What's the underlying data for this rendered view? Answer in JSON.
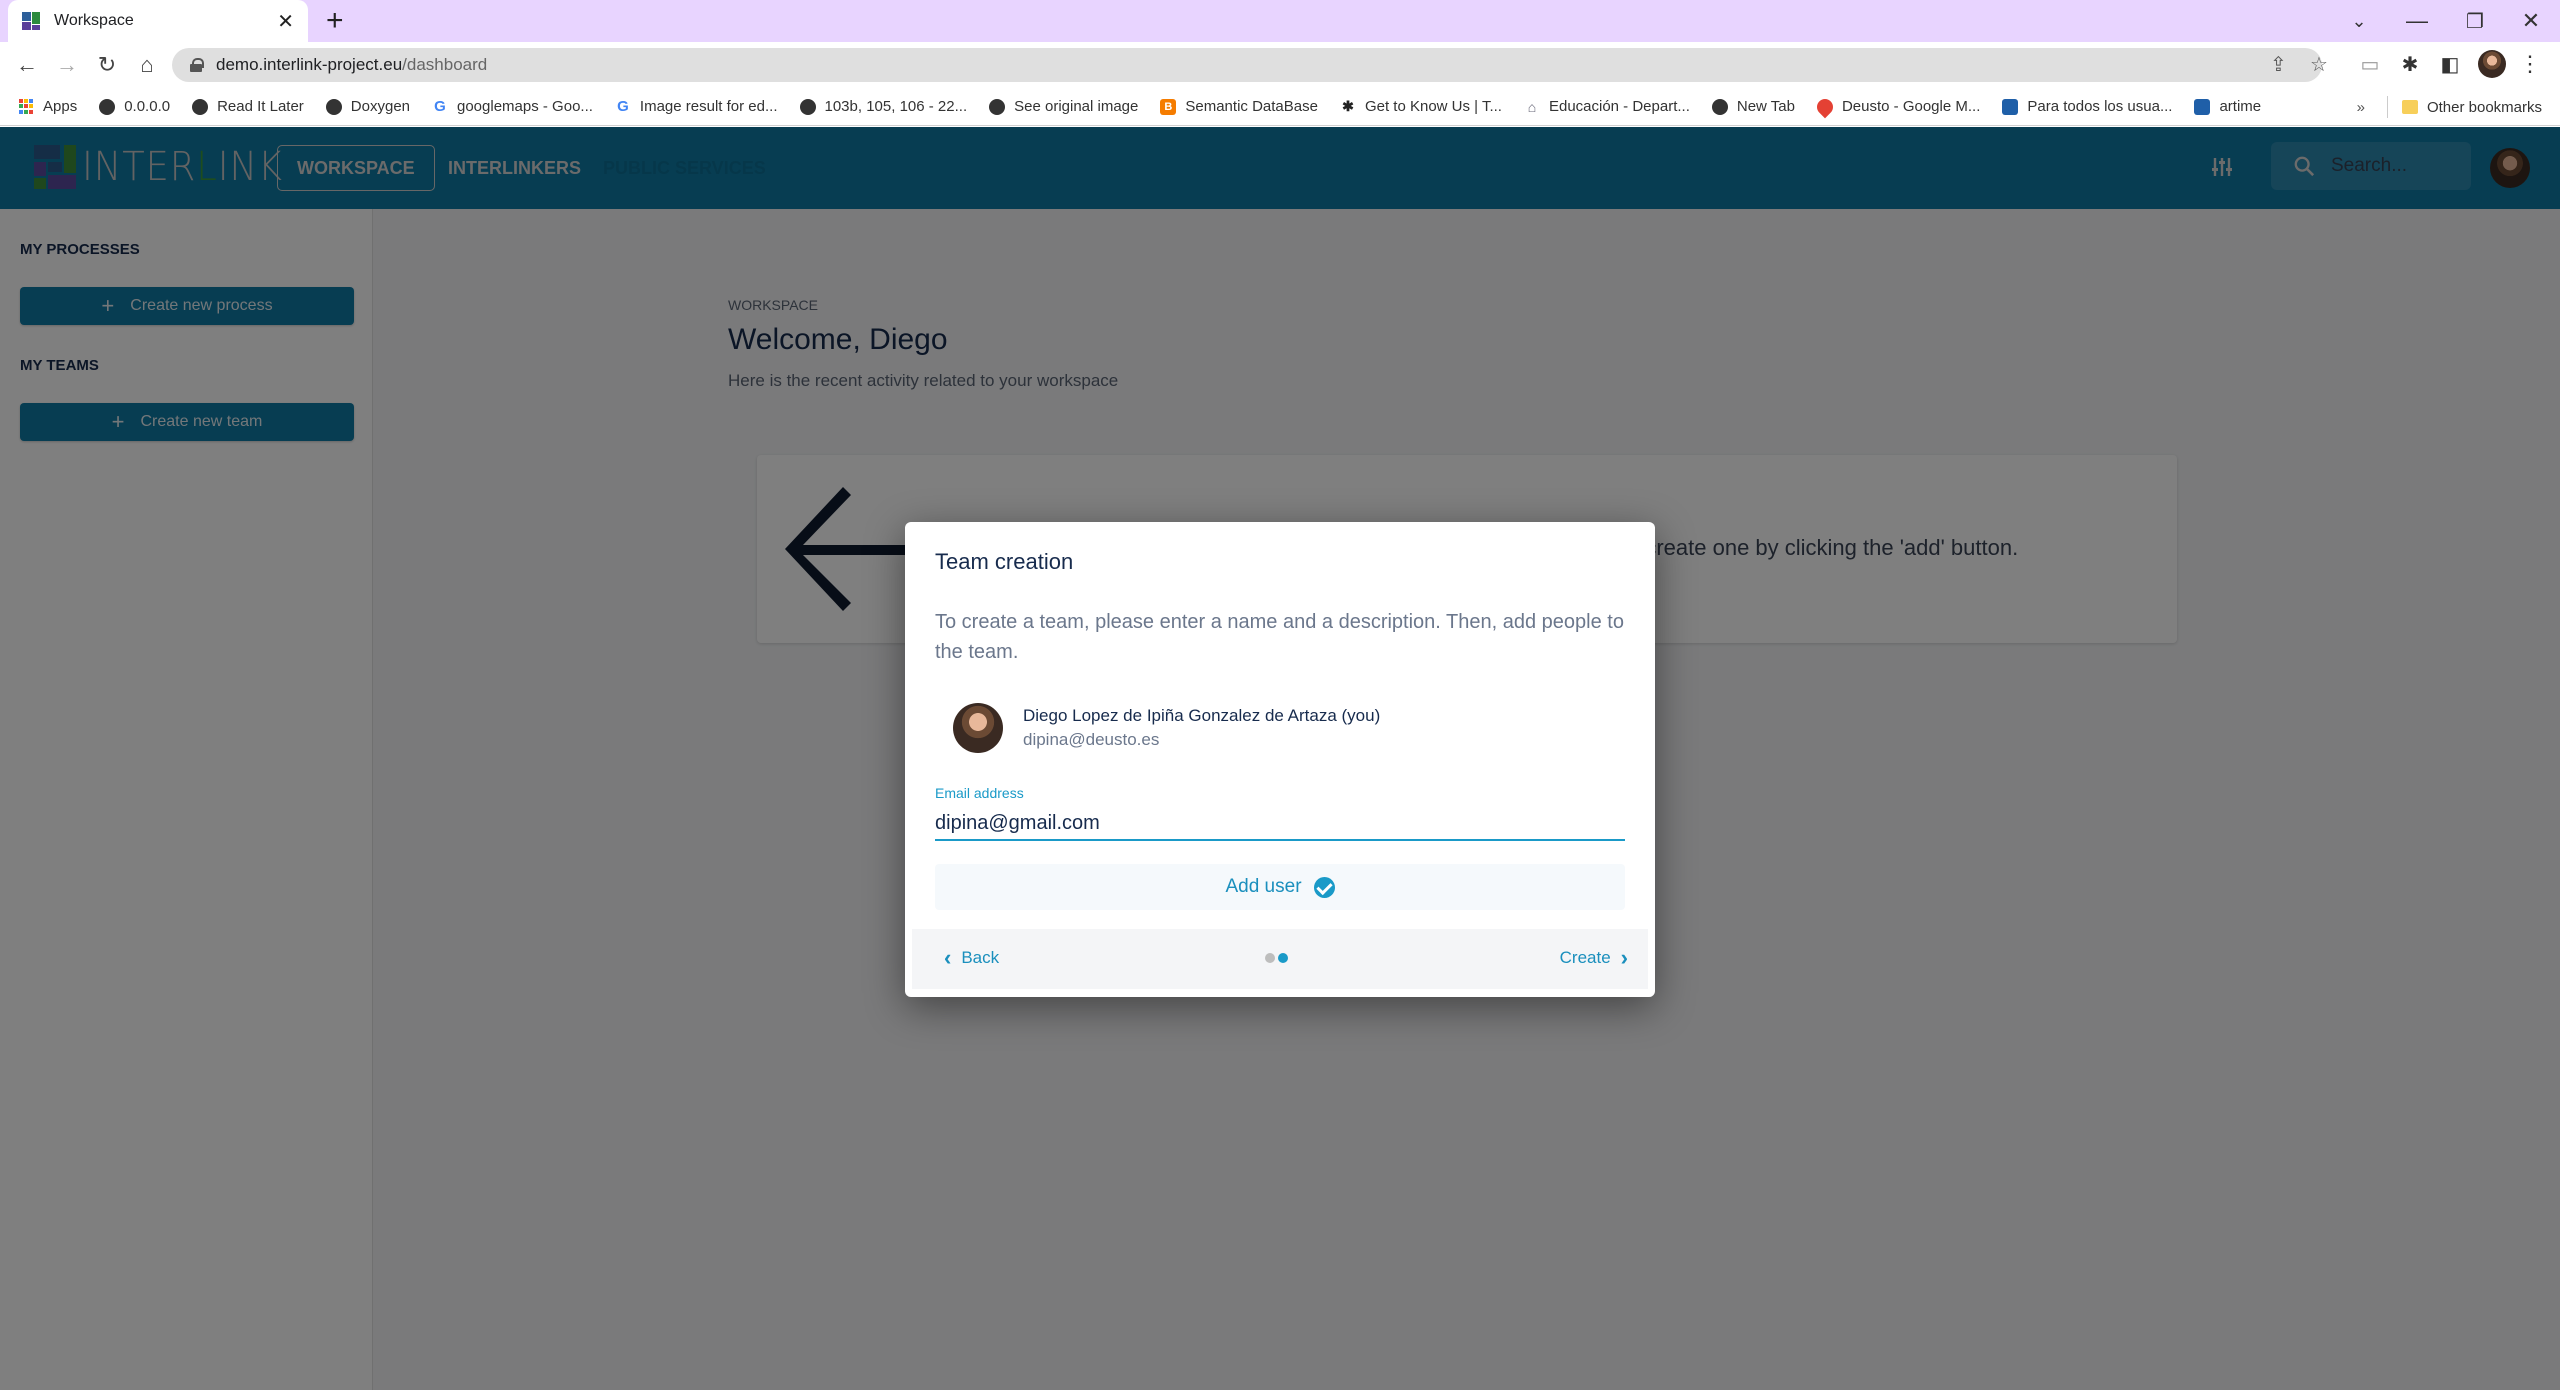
{
  "browser": {
    "tab_title": "Workspace",
    "url_domain": "demo.interlink-project.eu",
    "url_path": "/dashboard",
    "bookmarks": [
      {
        "label": "Apps",
        "icon": "apps-icon"
      },
      {
        "label": "0.0.0.0",
        "icon": "globe-icon"
      },
      {
        "label": "Read It Later",
        "icon": "globe-icon"
      },
      {
        "label": "Doxygen",
        "icon": "globe-icon"
      },
      {
        "label": "googlemaps - Goo...",
        "icon": "google-icon"
      },
      {
        "label": "Image result for ed...",
        "icon": "google-icon"
      },
      {
        "label": "103b, 105, 106 - 22...",
        "icon": "globe-icon"
      },
      {
        "label": "See original image",
        "icon": "globe-icon"
      },
      {
        "label": "Semantic DataBase",
        "icon": "blogger-icon"
      },
      {
        "label": "Get to Know Us | T...",
        "icon": "site-icon"
      },
      {
        "label": "Educación - Depart...",
        "icon": "site-icon"
      },
      {
        "label": "New Tab",
        "icon": "globe-icon"
      },
      {
        "label": "Deusto - Google M...",
        "icon": "map-pin-icon"
      },
      {
        "label": "Para todos los usua...",
        "icon": "shield-icon"
      },
      {
        "label": "artime",
        "icon": "shield-icon"
      }
    ],
    "overflow": "»",
    "other_bookmarks": "Other bookmarks"
  },
  "header": {
    "logo_text_1": "INTER",
    "logo_text_2": "L",
    "logo_text_3": "INK",
    "nav": [
      {
        "label": "WORKSPACE",
        "active": true
      },
      {
        "label": "INTERLINKERS",
        "active": false
      },
      {
        "label": "PUBLIC SERVICES",
        "active": false
      }
    ],
    "search_placeholder": "Search..."
  },
  "sidebar": {
    "processes_heading": "MY PROCESSES",
    "create_process_label": "Create new process",
    "teams_heading": "MY TEAMS",
    "create_team_label": "Create new team"
  },
  "main": {
    "breadcrumb": "WORKSPACE",
    "title": "Welcome, Diego",
    "subtitle": "Here is the recent activity related to your workspace",
    "empty_text": "n create one by clicking the 'add' button."
  },
  "modal": {
    "title": "Team creation",
    "description": "To create a team, please enter a name and a description. Then, add people to the team.",
    "user": {
      "name": "Diego Lopez de Ipiña Gonzalez de Artaza (you)",
      "email": "dipina@deusto.es"
    },
    "email_label": "Email address",
    "email_value": "dipina@gmail.com",
    "add_user_label": "Add user",
    "back_label": "Back",
    "create_label": "Create",
    "steps": {
      "total": 2,
      "current": 2
    }
  },
  "colors": {
    "brand": "#0f7ba5",
    "accent": "#1a9ac8",
    "tab_strip": "#e8d4ff"
  }
}
